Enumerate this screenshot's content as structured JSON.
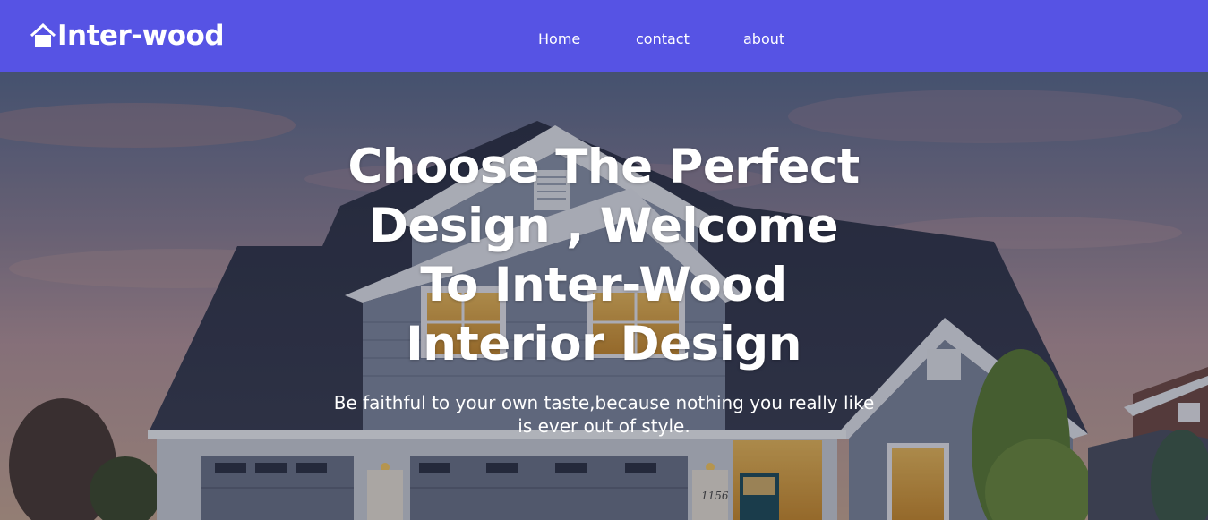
{
  "navbar": {
    "brand": {
      "icon": "house-icon",
      "text": "Inter-wood"
    },
    "links": {
      "home": "Home",
      "contact": "contact",
      "about": "about"
    }
  },
  "hero": {
    "title": "Choose The Perfect Design , Welcome To Inter-Wood Interior Design",
    "subtitle": "Be faithful to your own taste,because nothing you really like is ever out of style.",
    "house_number": "1156"
  },
  "colors": {
    "navbar_bg": "#5653e4",
    "text": "#ffffff"
  }
}
